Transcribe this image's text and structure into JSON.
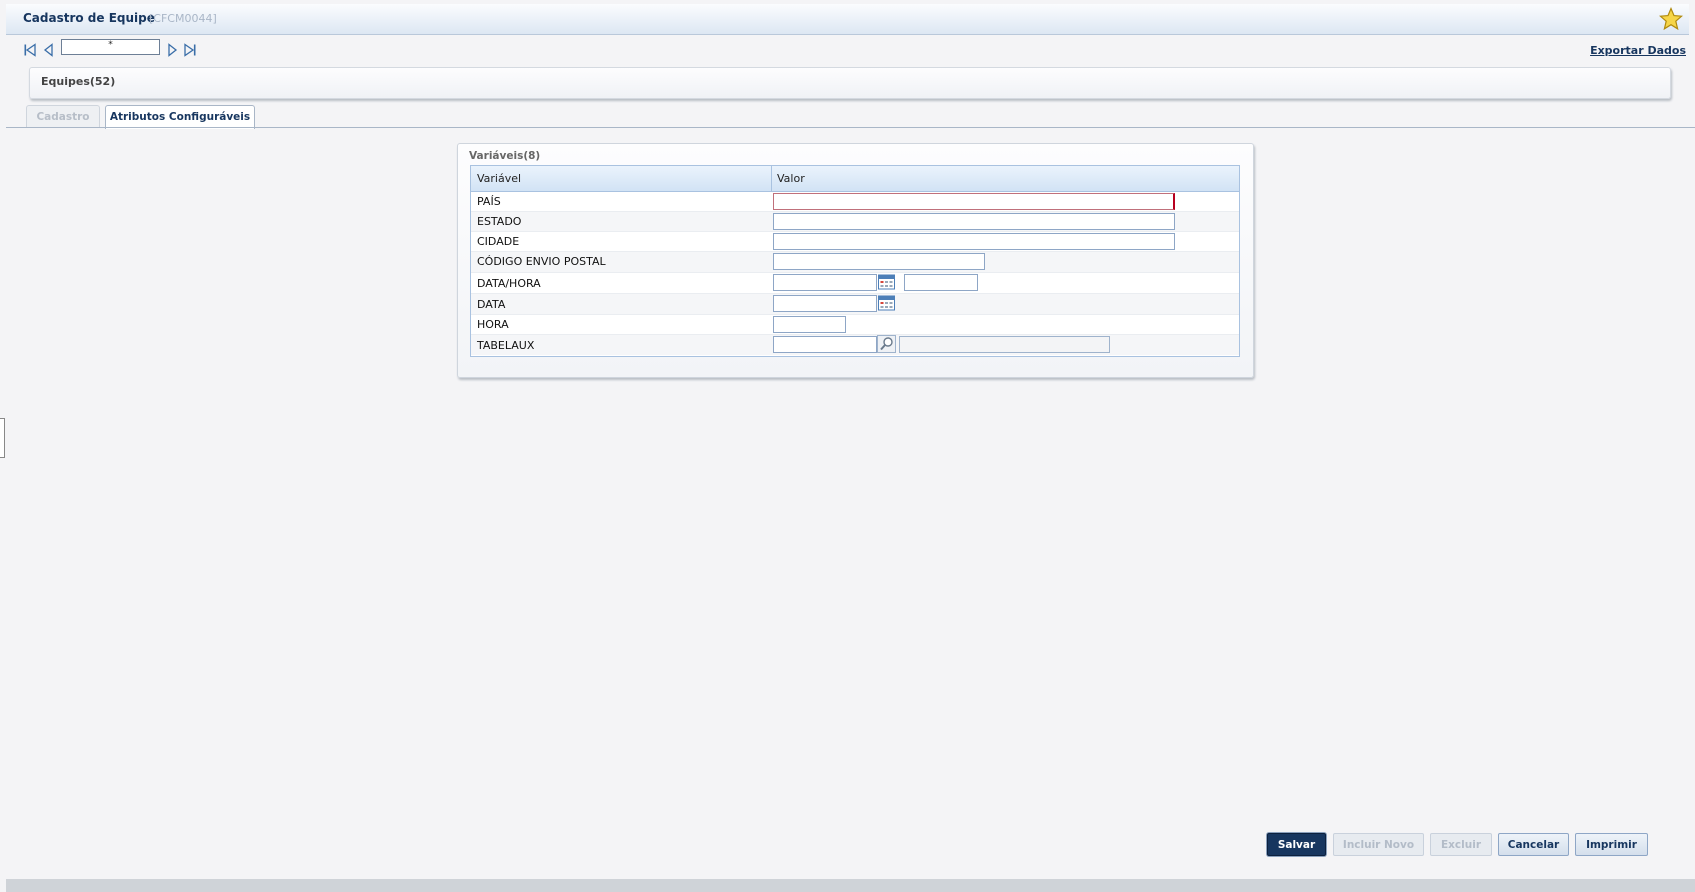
{
  "window": {
    "title": "Cadastro de Equipe",
    "code": "[CFCM0044]",
    "favorite_icon": "star-icon"
  },
  "navbar": {
    "record_value": "*",
    "icons": [
      "first-record-icon",
      "previous-record-icon",
      "next-record-icon",
      "last-record-icon"
    ],
    "export_label": "Exportar Dados"
  },
  "equipes": {
    "label": "Equipes(52)"
  },
  "tabs": [
    {
      "label": "Cadastro",
      "active": false,
      "enabled": false
    },
    {
      "label": "Atributos Configuráveis",
      "active": true,
      "enabled": true
    }
  ],
  "variables": {
    "title": "Variáveis(8)",
    "columns": [
      "Variável",
      "Valor"
    ],
    "rows": [
      {
        "label": "PAÍS",
        "value": ""
      },
      {
        "label": "ESTADO",
        "value": ""
      },
      {
        "label": "CIDADE",
        "value": ""
      },
      {
        "label": "CÓDIGO ENVIO POSTAL",
        "value": ""
      },
      {
        "label": "DATA/HORA",
        "value": ""
      },
      {
        "label": "DATA",
        "value": ""
      },
      {
        "label": "HORA",
        "value": ""
      },
      {
        "label": "TABELAUX",
        "value": ""
      }
    ]
  },
  "buttons": {
    "salvar": "Salvar",
    "incluir_novo": "Incluir Novo",
    "excluir": "Excluir",
    "cancelar": "Cancelar",
    "imprimir": "Imprimir"
  },
  "colors": {
    "brand_dark": "#17365f",
    "error_border": "#b8001f",
    "grid_header": "#d2e3f5"
  }
}
